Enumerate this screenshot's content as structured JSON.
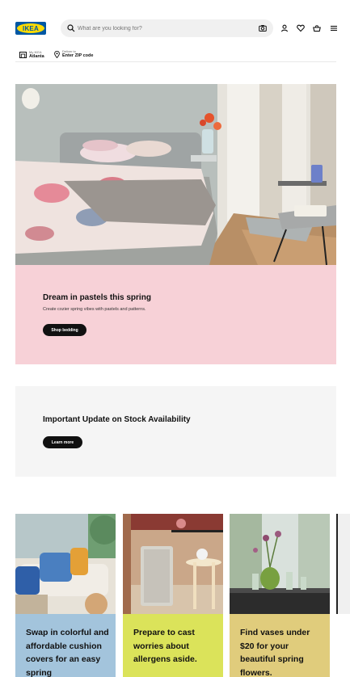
{
  "header": {
    "logo_text": "IKEA",
    "search_placeholder": "What are you looking for?",
    "icons": [
      "search-icon",
      "camera-icon",
      "user-icon",
      "heart-icon",
      "cart-icon",
      "menu-icon"
    ],
    "store_label": "My IKEA",
    "store_value": "Atlanta",
    "deliver_label": "Deliver to",
    "deliver_value": "Enter ZIP code"
  },
  "hero": {
    "title": "Dream in pastels this spring",
    "subtitle": "Create cozier spring vibes with pastels and patterns.",
    "button": "Shop bedding",
    "panel_color": "#f7d1d7"
  },
  "stock_update": {
    "title": "Important Update on Stock Availability",
    "button": "Learn more",
    "panel_color": "#f5f5f5"
  },
  "cards": [
    {
      "text": "Swap in colorful and affordable cushion covers for an easy spring",
      "color": "#a3c4dc"
    },
    {
      "text": "Prepare to cast worries about allergens aside.",
      "color": "#dbe35a"
    },
    {
      "text": "Find vases under $20 for your beautiful spring flowers.",
      "color": "#e0cc7c"
    }
  ],
  "colors": {
    "brand_blue": "#0058a3",
    "brand_yellow": "#ffdb00",
    "button_dark": "#111111"
  }
}
